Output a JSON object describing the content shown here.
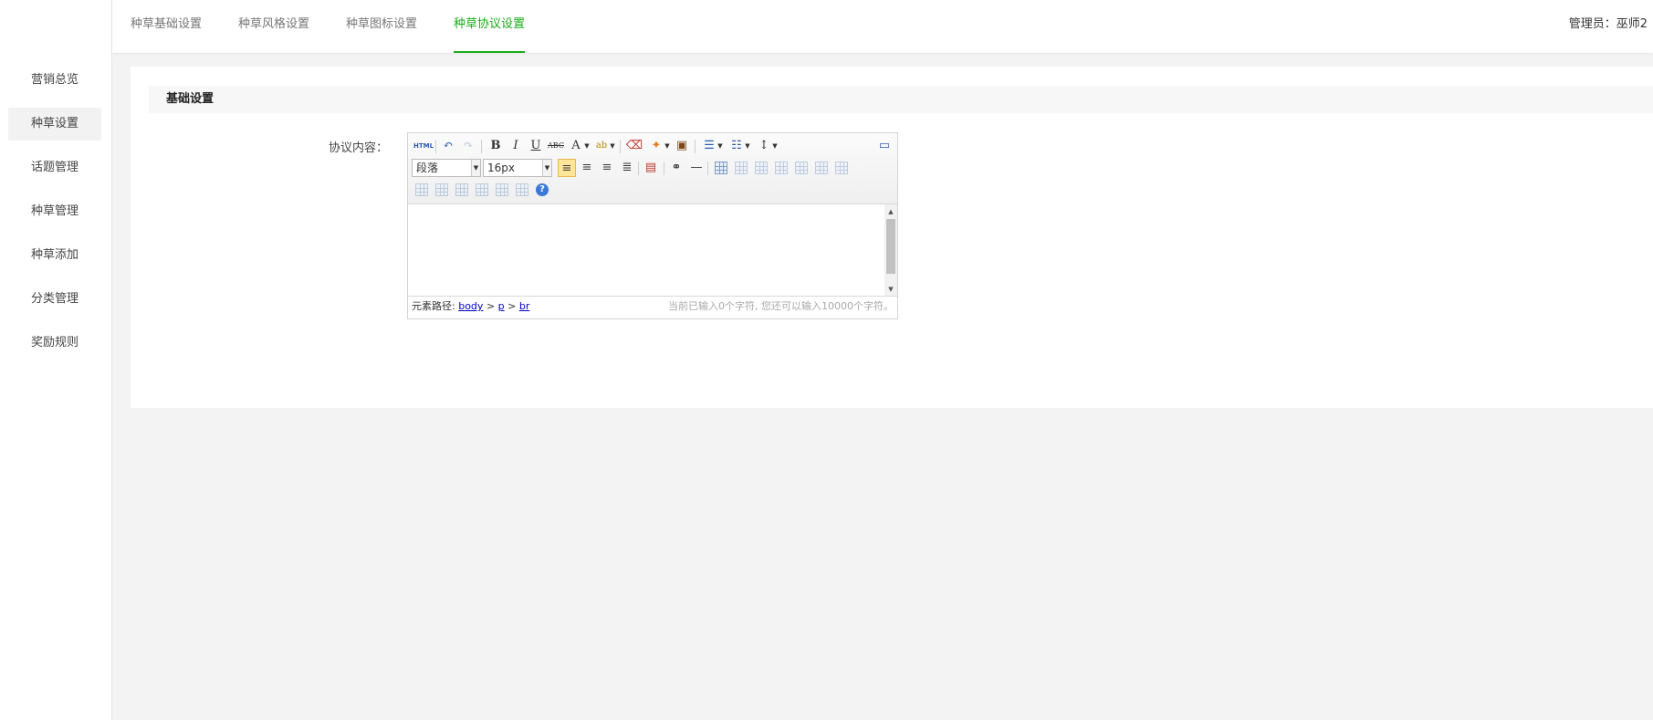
{
  "sidebar": {
    "items": [
      {
        "label": "营销总览",
        "active": false
      },
      {
        "label": "种草设置",
        "active": true
      },
      {
        "label": "话题管理",
        "active": false
      },
      {
        "label": "种草管理",
        "active": false
      },
      {
        "label": "种草添加",
        "active": false
      },
      {
        "label": "分类管理",
        "active": false
      },
      {
        "label": "奖励规则",
        "active": false
      }
    ]
  },
  "header": {
    "tabs": [
      {
        "label": "种草基础设置",
        "active": false
      },
      {
        "label": "种草风格设置",
        "active": false
      },
      {
        "label": "种草图标设置",
        "active": false
      },
      {
        "label": "种草协议设置",
        "active": true
      }
    ],
    "admin_label": "管理员：",
    "admin_name": "巫师2"
  },
  "section": {
    "title": "基础设置"
  },
  "form": {
    "agreement_label": "协议内容："
  },
  "editor": {
    "html_button": "HTML",
    "paragraph_select": "段落",
    "fontsize_select": "16px",
    "path_label": "元素路径:",
    "path": [
      "body",
      "p",
      "br"
    ],
    "path_separator": ">",
    "char_count": "当前已输入0个字符, 您还可以输入10000个字符。",
    "help_glyph": "?"
  },
  "colors": {
    "accent": "#1aad19",
    "background": "#f3f3f3"
  }
}
